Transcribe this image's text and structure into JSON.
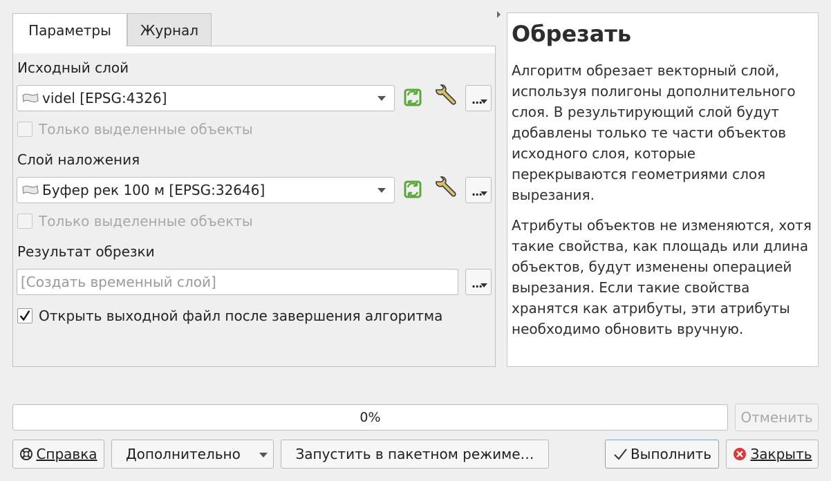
{
  "tabs": [
    {
      "label": "Параметры",
      "active": true
    },
    {
      "label": "Журнал",
      "active": false
    }
  ],
  "params": {
    "input_layer": {
      "label": "Исходный слой",
      "value": "videl [EPSG:4326]",
      "selected_only": "Только выделенные объекты"
    },
    "overlay_layer": {
      "label": "Слой наложения",
      "value": "Буфер рек 100 м [EPSG:32646]",
      "selected_only": "Только выделенные объекты"
    },
    "output": {
      "label": "Результат обрезки",
      "placeholder": "[Создать временный слой]"
    },
    "open_output": {
      "label": "Открыть выходной файл после завершения алгоритма",
      "checked": true
    },
    "more_button": "..."
  },
  "help": {
    "title": "Обрезать",
    "paragraphs": [
      "Алгоритм обрезает векторный слой, используя полигоны дополнительного слоя. В результирующий слой будут добавлены только те части объектов исходного слоя, которые перекрываются геометриями слоя вырезания.",
      "Атрибуты объектов не изменяются, хотя такие свойства, как площадь или длина объектов, будут изменены операцией вырезания. Если такие свойства хранятся как атрибуты, эти атрибуты необходимо обновить вручную."
    ]
  },
  "progress": {
    "text": "0%",
    "value": 0
  },
  "buttons": {
    "cancel": "Отменить",
    "help": "Справка",
    "advanced": "Дополнительно",
    "batch": "Запустить в пакетном режиме…",
    "run": "Выполнить",
    "close": "Закрыть"
  },
  "colors": {
    "accent": "#7aa6d2",
    "refresh_green": "#5aa83a",
    "close_red": "#d83a3a"
  },
  "icons": {
    "layer": "polygon-layer-icon",
    "refresh": "refresh-icon",
    "settings": "wrench-icon",
    "help": "lifebuoy-icon",
    "run": "checkmark-icon",
    "close": "close-icon"
  }
}
